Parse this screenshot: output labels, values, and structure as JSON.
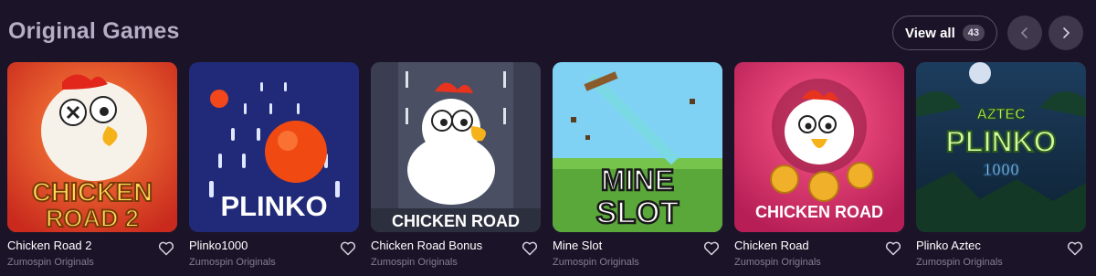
{
  "section": {
    "title": "Original Games",
    "view_all_label": "View all",
    "view_all_count": "43"
  },
  "games": [
    {
      "name": "Chicken Road 2",
      "provider": "Zumospin Originals",
      "art_text": [
        "CHICKEN",
        "ROAD 2"
      ],
      "bg": "#e0452b"
    },
    {
      "name": "Plinko1000",
      "provider": "Zumospin Originals",
      "art_text": [
        "PLINKO"
      ],
      "bg": "#202a78"
    },
    {
      "name": "Chicken Road Bonus",
      "provider": "Zumospin Originals",
      "art_text": [
        "CHICKEN ROAD"
      ],
      "bg": "#4a4f63"
    },
    {
      "name": "Mine Slot",
      "provider": "Zumospin Originals",
      "art_text": [
        "MINE",
        "SLOT"
      ],
      "bg": "#5fc3ee"
    },
    {
      "name": "Chicken Road",
      "provider": "Zumospin Originals",
      "art_text": [
        "CHICKEN ROAD"
      ],
      "bg": "#d9306a"
    },
    {
      "name": "Plinko Aztec",
      "provider": "Zumospin Originals",
      "art_text": [
        "AZTEC",
        "PLINKO",
        "1000"
      ],
      "bg": "#173049"
    }
  ],
  "icons": {
    "prev": "chevron-left-icon",
    "next": "chevron-right-icon",
    "favorite": "heart-outline-icon"
  }
}
